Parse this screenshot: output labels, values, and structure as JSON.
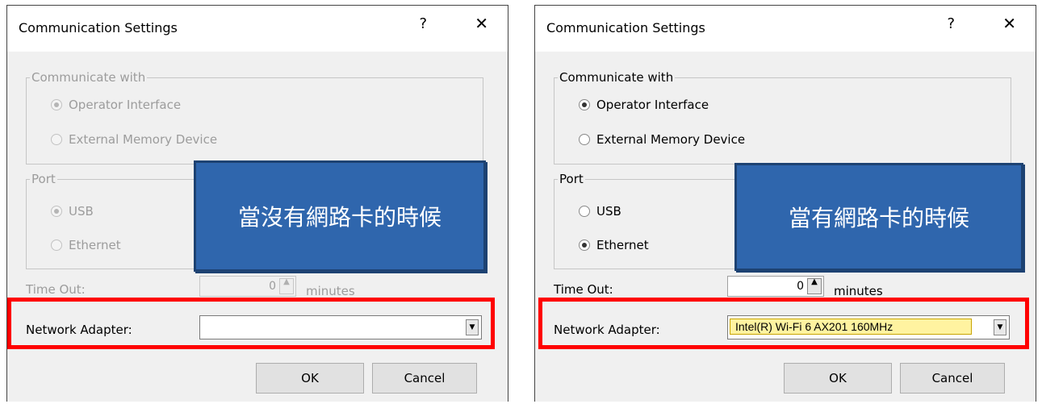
{
  "left_dialog": {
    "title": "Communication Settings",
    "help_glyph": "?",
    "close_glyph": "✕",
    "group_communicate": {
      "legend": "Communicate with",
      "options": [
        "Operator Interface",
        "External Memory Device"
      ],
      "selected": "Operator Interface"
    },
    "group_port": {
      "legend": "Port",
      "options": [
        "USB",
        "Ethernet"
      ],
      "selected": "USB"
    },
    "timeout_label": "Time Out:",
    "timeout_value": "0",
    "minutes_label": "minutes",
    "network_adapter_label": "Network Adapter:",
    "network_adapter_value": "",
    "ok_label": "OK",
    "cancel_label": "Cancel",
    "state": "disabled"
  },
  "right_dialog": {
    "title": "Communication Settings",
    "help_glyph": "?",
    "close_glyph": "✕",
    "group_communicate": {
      "legend": "Communicate with",
      "options": [
        "Operator Interface",
        "External Memory Device"
      ],
      "selected": "Operator Interface"
    },
    "group_port": {
      "legend": "Port",
      "options": [
        "USB",
        "Ethernet"
      ],
      "selected": "Ethernet"
    },
    "timeout_label": "Time Out:",
    "timeout_value": "0",
    "minutes_label": "minutes",
    "network_adapter_label": "Network Adapter:",
    "network_adapter_value": "Intel(R) Wi-Fi 6 AX201 160MHz",
    "ok_label": "OK",
    "cancel_label": "Cancel",
    "state": "enabled"
  },
  "annotations": {
    "left_callout": "當沒有網路卡的時候",
    "right_callout": "當有網路卡的時候",
    "highlight_color": "#ff0000",
    "callout_color": "#2f66ad"
  },
  "icons": {
    "spin_up": "▲",
    "dropdown": "▼"
  }
}
